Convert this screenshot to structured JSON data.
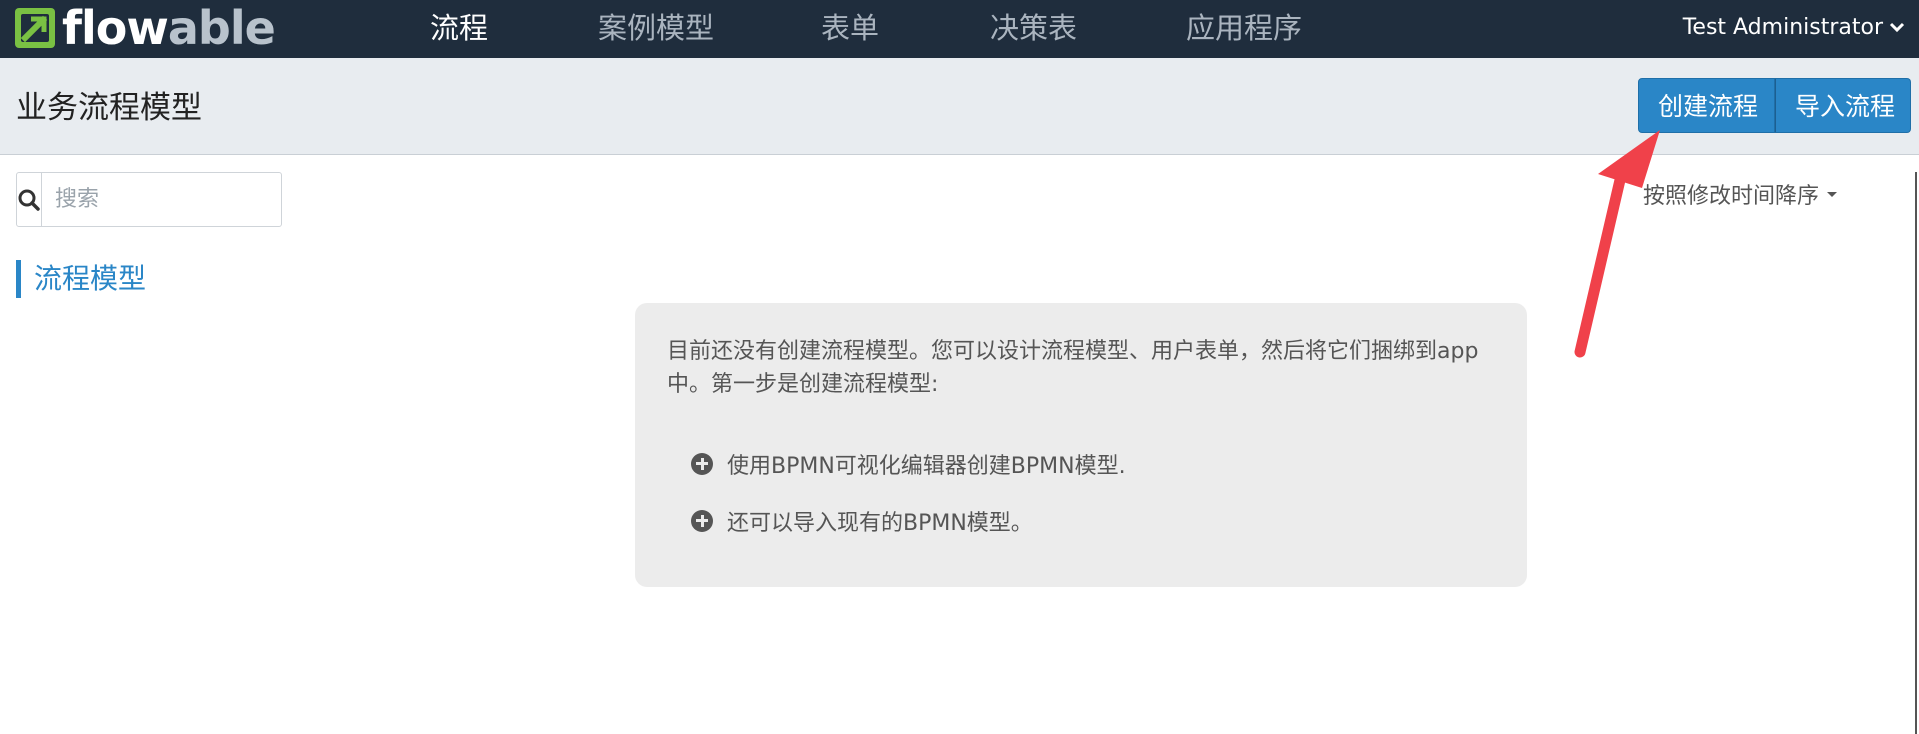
{
  "navbar": {
    "logo": {
      "part1": "flow",
      "part2": "able"
    },
    "items": [
      {
        "label": "流程",
        "active": true
      },
      {
        "label": "案例模型",
        "active": false
      },
      {
        "label": "表单",
        "active": false
      },
      {
        "label": "决策表",
        "active": false
      },
      {
        "label": "应用程序",
        "active": false
      }
    ],
    "user": {
      "name": "Test Administrator",
      "icon": "chevron-down-icon"
    }
  },
  "header": {
    "title": "业务流程模型",
    "buttons": {
      "create_label": "创建流程",
      "import_label": "导入流程"
    }
  },
  "search": {
    "placeholder": "搜索",
    "value": "",
    "icon": "search-icon"
  },
  "sidebar": {
    "filter_label": "流程模型"
  },
  "sort": {
    "label": "按照修改时间降序"
  },
  "empty_state": {
    "message": "目前还没有创建流程模型。您可以设计流程模型、用户表单，然后将它们捆绑到app中。第一步是创建流程模型:",
    "items": [
      {
        "text": "使用BPMN可视化编辑器创建BPMN模型.",
        "icon": "plus-circle-icon"
      },
      {
        "text": "还可以导入现有的BPMN模型。",
        "icon": "plus-circle-icon"
      }
    ]
  },
  "colors": {
    "navbar_bg": "#1f2d3d",
    "accent": "#2a86c7",
    "logo_green": "#7ac143",
    "arrow": "#f0414a"
  }
}
